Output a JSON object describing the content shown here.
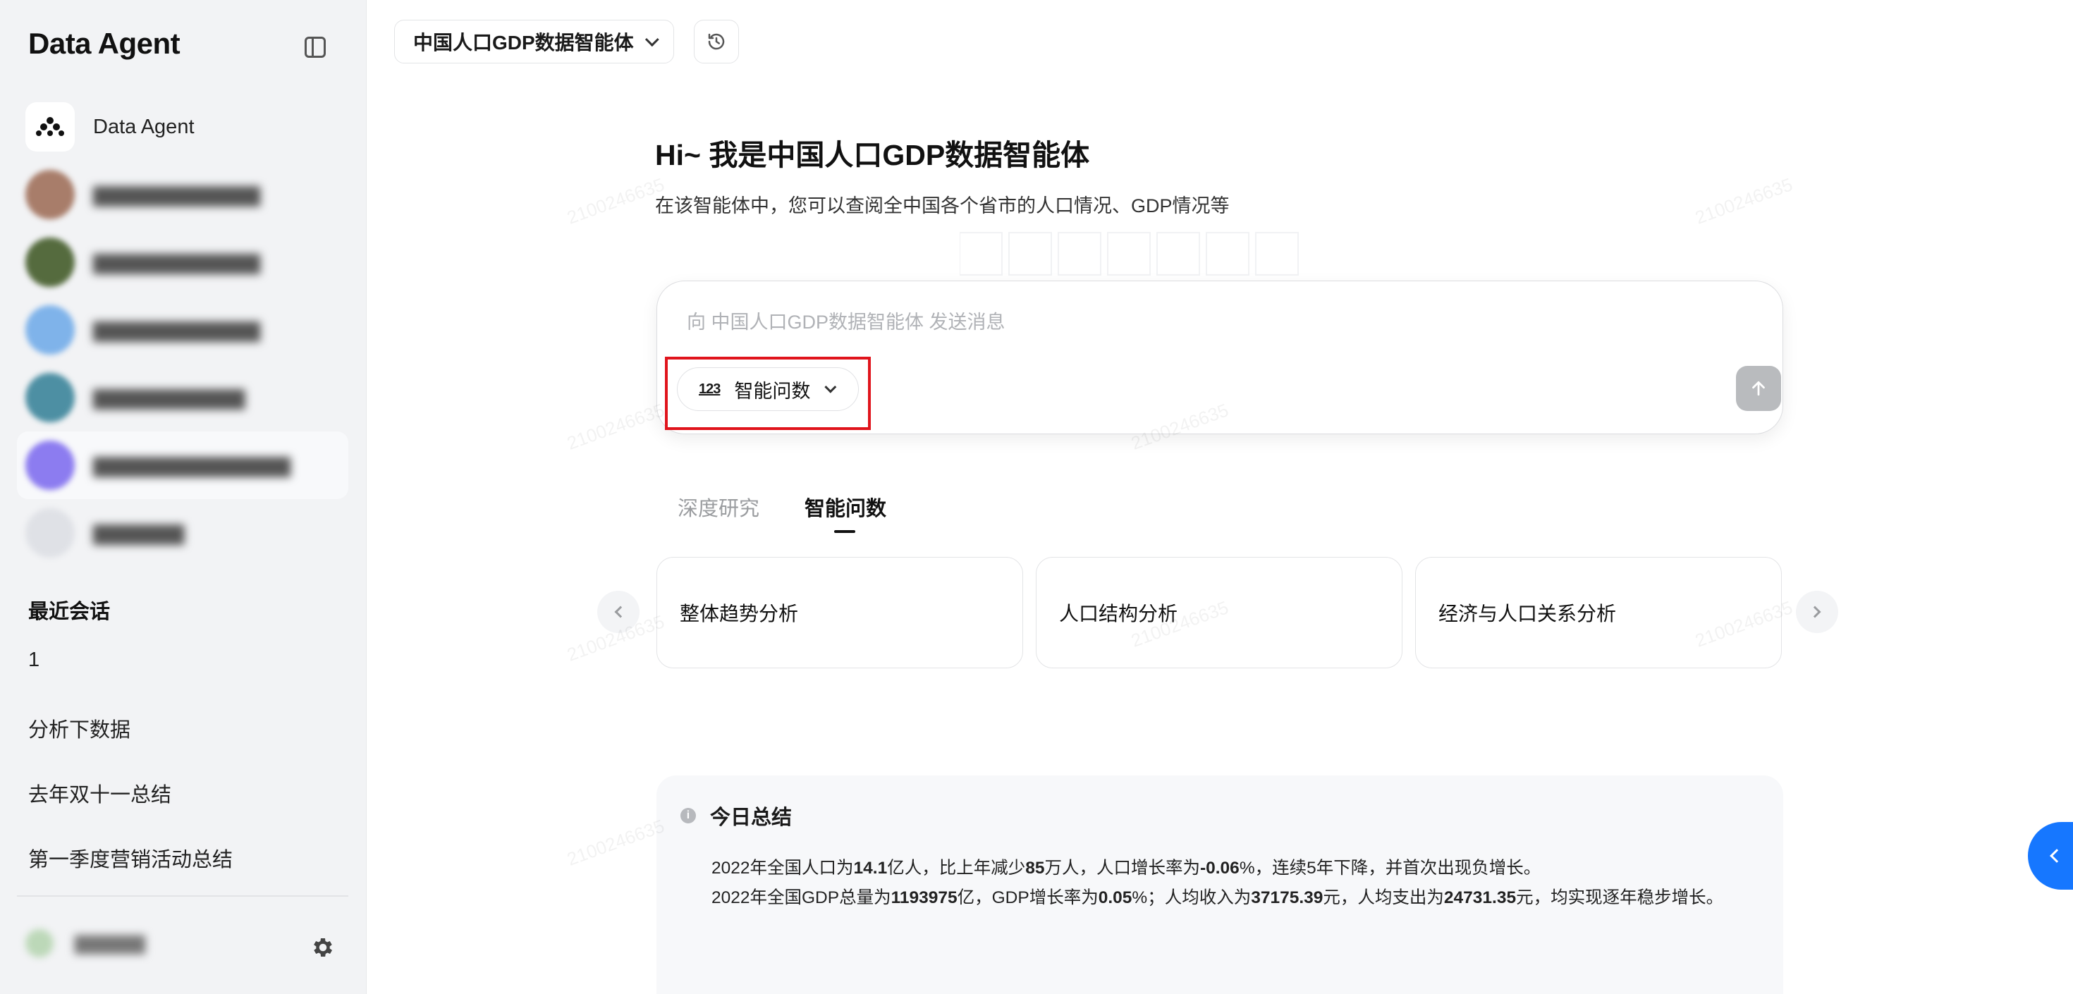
{
  "app": {
    "logo": "Data Agent"
  },
  "sidebar": {
    "agents": [
      {
        "label": "Data Agent",
        "icon": "data-agent-logo-icon",
        "active": false
      },
      {
        "label": "",
        "icon": "avatar",
        "blurred": true
      },
      {
        "label": "",
        "icon": "avatar",
        "blurred": true
      },
      {
        "label": "",
        "icon": "avatar",
        "blurred": true
      },
      {
        "label": "",
        "icon": "avatar",
        "blurred": true
      },
      {
        "label": "",
        "icon": "avatar",
        "blurred": true,
        "active": true
      },
      {
        "label": "",
        "icon": "avatar",
        "blurred": true
      }
    ],
    "recent_title": "最近会话",
    "sessions": [
      "1",
      "分析下数据",
      "去年双十一总结",
      "第一季度营销活动总结"
    ],
    "user_name": ""
  },
  "header": {
    "agent_select": "中国人口GDP数据智能体"
  },
  "main": {
    "greeting": "Hi~ 我是中国人口GDP数据智能体",
    "subtitle": "在该智能体中，您可以查阅全中国各个省市的人口情况、GDP情况等",
    "input": {
      "placeholder": "向 中国人口GDP数据智能体 发送消息",
      "value": ""
    },
    "mode_button": {
      "icon_text": "123",
      "label": "智能问数"
    },
    "tabs": [
      {
        "label": "深度研究",
        "active": false
      },
      {
        "label": "智能问数",
        "active": true
      }
    ],
    "prompt_cards": [
      "整体趋势分析",
      "人口结构分析",
      "经济与人口关系分析"
    ],
    "summary": {
      "title": "今日总结",
      "line1": {
        "p1": "2022年全国人口为",
        "v1": "14.1",
        "p2": "亿人，比上年减少",
        "v2": "85",
        "p3": "万人，人口增长率为",
        "v3": "-0.06",
        "p4": "%，连续5年下降，并首次出现负增长。"
      },
      "line2": {
        "p1": "2022年全国GDP总量为",
        "v1": "1193975",
        "p2": "亿，GDP增长率为",
        "v2": "0.05",
        "p3": "%；人均收入为",
        "v3": "37175.39",
        "p4": "元，人均支出为",
        "v4": "24731.35",
        "p5": "元，均实现逐年稳步增长。"
      }
    },
    "watermark": "2100246635"
  },
  "colors": {
    "accent": "#1677ff",
    "highlight": "#e0141c",
    "sidebar_bg": "#f2f3f5"
  }
}
